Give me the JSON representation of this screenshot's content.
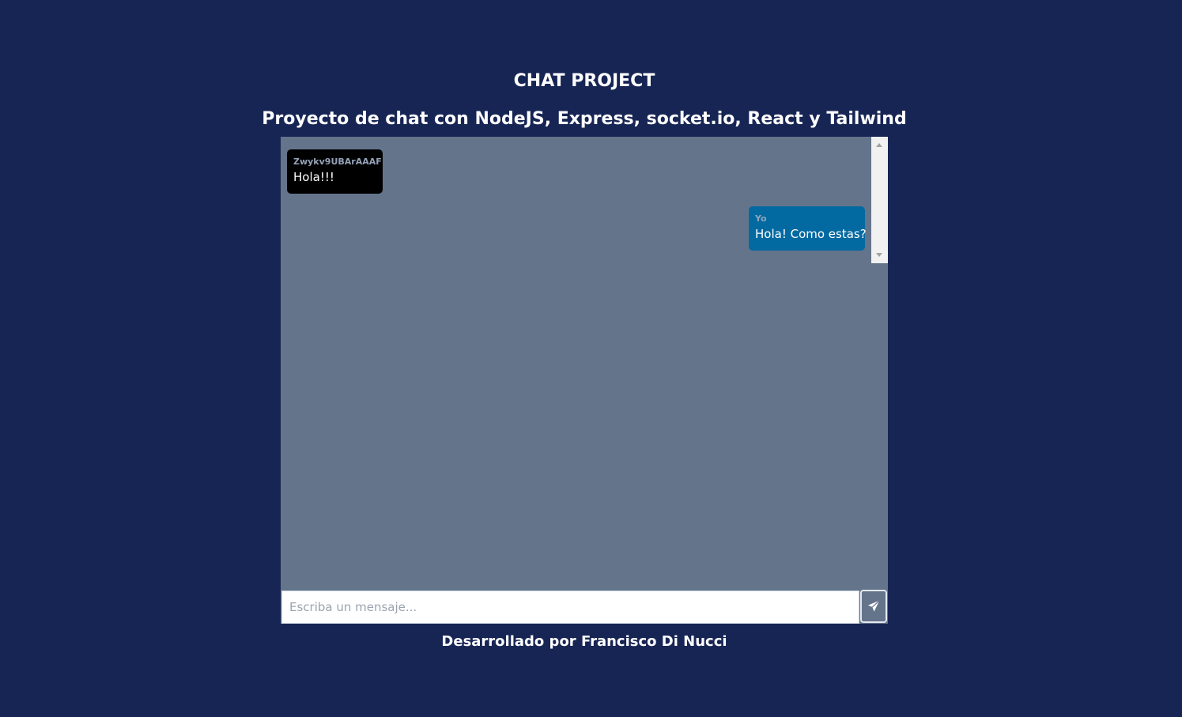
{
  "header": {
    "title": "CHAT PROJECT",
    "subtitle": "Proyecto de chat con NodeJS, Express, socket.io, React y Tailwind"
  },
  "chat": {
    "messages": [
      {
        "sender": "Zwykv9UBArAAAF",
        "text": "Hola!!!",
        "from": "other"
      },
      {
        "sender": "Yo",
        "text": "Hola! Como estas?",
        "from": "me"
      }
    ]
  },
  "composer": {
    "placeholder": "Escriba un mensaje...",
    "value": "",
    "send_icon": "paper-plane-icon"
  },
  "footer": {
    "credit": "Desarrollado por Francisco Di Nucci"
  },
  "colors": {
    "background": "#172554",
    "chat_panel": "#64748b",
    "bubble_other": "#000000",
    "bubble_me": "#0369a1"
  }
}
